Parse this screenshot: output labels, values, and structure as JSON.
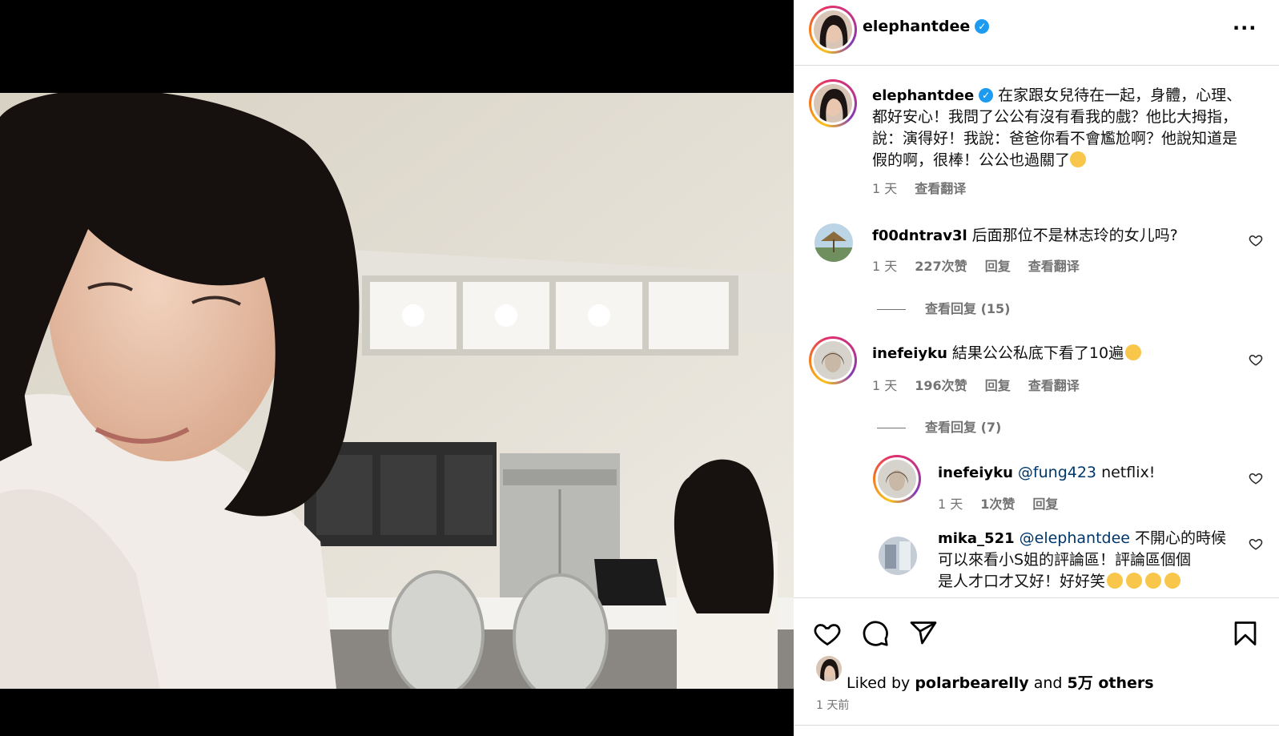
{
  "post": {
    "author": "elephantdee",
    "verified": true,
    "more_icon": "more-horizontal-icon"
  },
  "caption": {
    "username": "elephantdee",
    "text": "在家跟女兒待在一起，身體，心理、都好安心！我問了公公有沒有看我的戲？他比大拇指，說：演得好！我說：爸爸你看不會尷尬啊？他說知道是假的啊，很棒！公公也過關了",
    "time": "1 天",
    "translate": "查看翻译"
  },
  "comments": [
    {
      "username": "f00dntrav3l",
      "text": "后面那位不是林志玲的女儿吗?",
      "time": "1 天",
      "likes": "227次赞",
      "reply": "回复",
      "translate": "查看翻译",
      "view_replies": "查看回复 (15)"
    },
    {
      "username": "inefeiyku",
      "text": "結果公公私底下看了10遍",
      "time": "1 天",
      "likes": "196次赞",
      "reply": "回复",
      "translate": "查看翻译",
      "view_replies": "查看回复 (7)"
    }
  ],
  "replies": [
    {
      "username": "inefeiyku",
      "mention": "@fung423",
      "text": "netflix!",
      "time": "1 天",
      "likes": "1次赞",
      "reply": "回复"
    },
    {
      "username": "mika_521",
      "mention": "@elephantdee",
      "text_line1": "不開心的時候",
      "text_line2": "可以來看小S姐的評論區！評論區個個",
      "text_line3": "是人才口才又好！好好笑"
    }
  ],
  "actions": {
    "like_icon": "heart-icon",
    "comment_icon": "comment-icon",
    "share_icon": "send-icon",
    "save_icon": "bookmark-icon"
  },
  "likes": {
    "prefix": "Liked by ",
    "user": "polarbearelly",
    "middle": " and ",
    "count": "5万",
    "suffix": " others"
  },
  "posted": "1 天前",
  "colors": {
    "verified": "#1d9bf0",
    "secondary_text": "#737373",
    "mention": "#00376b",
    "divider": "#dbdbdb"
  }
}
